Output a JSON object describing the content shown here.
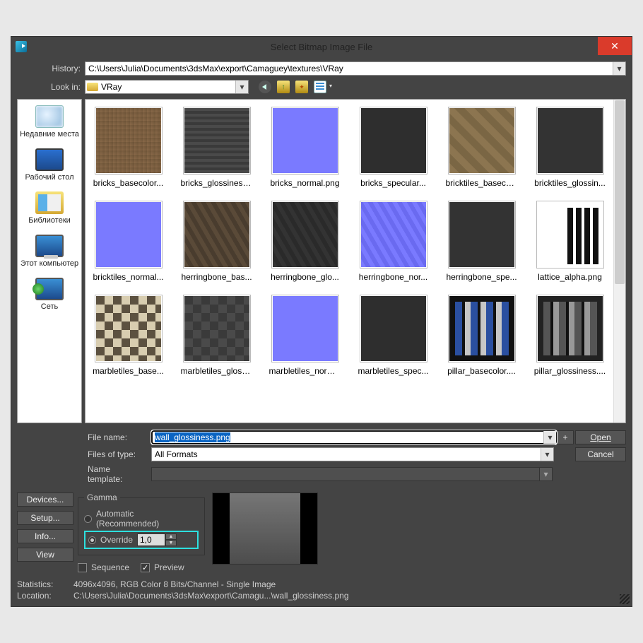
{
  "title": "Select Bitmap Image File",
  "close_x": "✕",
  "labels": {
    "history": "History:",
    "lookin": "Look in:",
    "filename": "File name:",
    "filesoftype": "Files of type:",
    "nametemplate": "Name template:",
    "statistics": "Statistics:",
    "location": "Location:"
  },
  "history_value": "C:\\Users\\Julia\\Documents\\3dsMax\\export\\Camaguey\\textures\\VRay",
  "lookin_value": "VRay",
  "places": [
    {
      "id": "recent",
      "label": "Недавние места"
    },
    {
      "id": "desktop",
      "label": "Рабочий стол"
    },
    {
      "id": "libraries",
      "label": "Библиотеки"
    },
    {
      "id": "computer",
      "label": "Этот компьютер"
    },
    {
      "id": "network",
      "label": "Сеть"
    }
  ],
  "files": [
    {
      "name": "bricks_basecolor...",
      "cls": "tx-br-base"
    },
    {
      "name": "bricks_glossiness...",
      "cls": "tx-gray-brick"
    },
    {
      "name": "bricks_normal.png",
      "cls": "tx-normal"
    },
    {
      "name": "bricks_specular...",
      "cls": "tx-spec"
    },
    {
      "name": "bricktiles_baseco...",
      "cls": "tx-bt-base"
    },
    {
      "name": "bricktiles_glossin...",
      "cls": "tx-dark"
    },
    {
      "name": "bricktiles_normal...",
      "cls": "tx-normal"
    },
    {
      "name": "herringbone_bas...",
      "cls": "tx-hb-base"
    },
    {
      "name": "herringbone_glo...",
      "cls": "tx-hb-gloss"
    },
    {
      "name": "herringbone_nor...",
      "cls": "tx-hb-norm"
    },
    {
      "name": "herringbone_spe...",
      "cls": "tx-dark"
    },
    {
      "name": "lattice_alpha.png",
      "cls": "tx-lattice"
    },
    {
      "name": "marbletiles_base...",
      "cls": "tx-marble-base"
    },
    {
      "name": "marbletiles_gloss...",
      "cls": "tx-marble-gloss"
    },
    {
      "name": "marbletiles_norm...",
      "cls": "tx-normal"
    },
    {
      "name": "marbletiles_spec...",
      "cls": "tx-spec"
    },
    {
      "name": "pillar_basecolor....",
      "cls": "tx-pillar-base"
    },
    {
      "name": "pillar_glossiness....",
      "cls": "tx-pillar-gloss"
    }
  ],
  "form": {
    "filename_value": "wall_glossiness.png",
    "filesoftype_value": "All Formats",
    "plus": "+",
    "open": "Open",
    "cancel": "Cancel"
  },
  "leftbuttons": {
    "devices": "Devices...",
    "setup": "Setup...",
    "info": "Info...",
    "view": "View"
  },
  "gamma": {
    "legend": "Gamma",
    "automatic": "Automatic (Recommended)",
    "override": "Override",
    "override_value": "1,0"
  },
  "checks": {
    "sequence": "Sequence",
    "preview": "Preview",
    "preview_checked": "✓"
  },
  "stats": {
    "value": "4096x4096, RGB Color 8 Bits/Channel - Single Image",
    "location": "C:\\Users\\Julia\\Documents\\3dsMax\\export\\Camagu...\\wall_glossiness.png"
  }
}
